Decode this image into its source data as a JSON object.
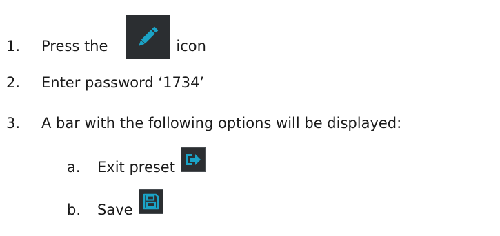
{
  "steps": [
    {
      "number": "1.",
      "text_before": "Press the",
      "text_after": "icon",
      "icon": "pencil-icon"
    },
    {
      "number": "2.",
      "text": "Enter password ‘1734’"
    },
    {
      "number": "3.",
      "text": "A bar with the following options will be displayed:"
    }
  ],
  "options": [
    {
      "letter": "a.",
      "label": "Exit preset",
      "icon": "exit-icon"
    },
    {
      "letter": "b.",
      "label": "Save",
      "icon": "save-icon"
    }
  ],
  "colors": {
    "icon_background": "#2b2e31",
    "icon_accent": "#1ba3c6"
  }
}
